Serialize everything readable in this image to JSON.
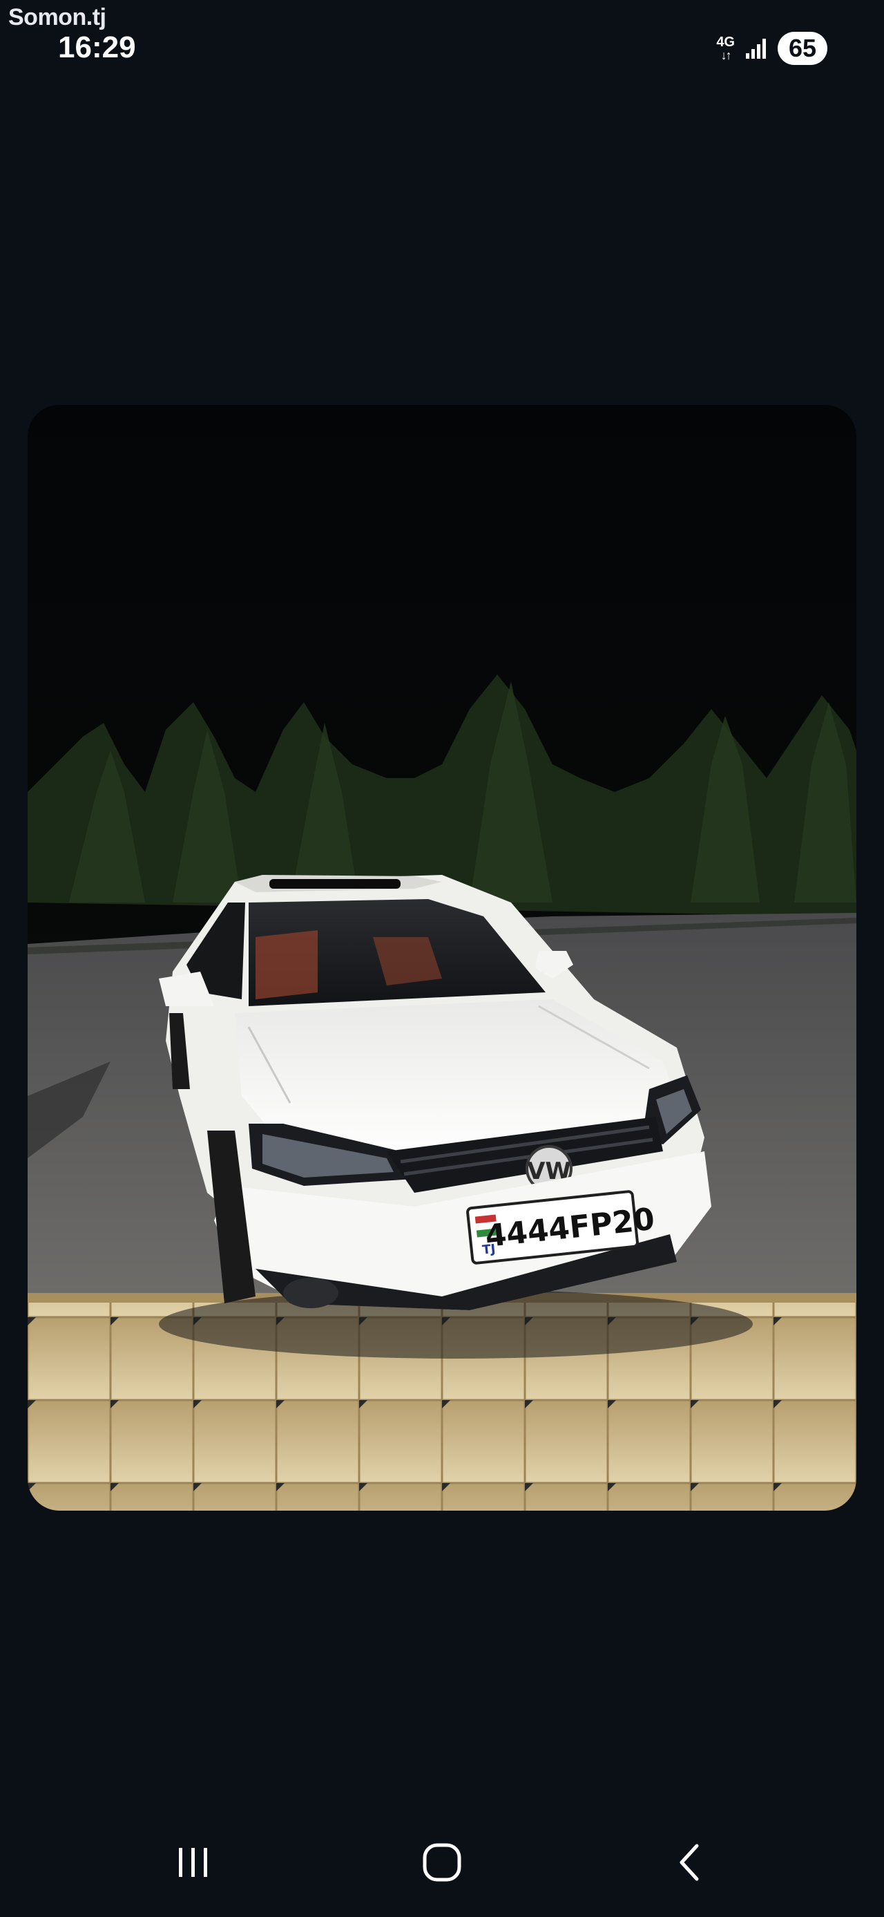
{
  "watermark": "Somon.tj",
  "status_bar": {
    "time": "16:29",
    "network": "4G",
    "battery": "65"
  },
  "photo": {
    "subject": "white Volkswagen sedan parked at night",
    "plate_country": "TJ",
    "plate_number": "4444FP20"
  },
  "nav_bar": {
    "buttons": [
      "recents-icon",
      "home-icon",
      "back-icon"
    ]
  },
  "colors": {
    "background": "#0b0f16",
    "car": "#f3f3f1",
    "pavement": "#d8c6a0"
  }
}
